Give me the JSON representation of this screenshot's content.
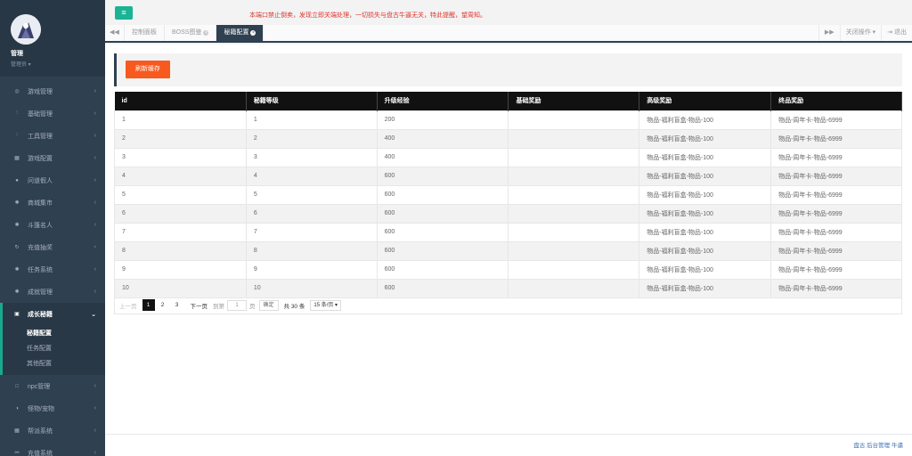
{
  "profile": {
    "name": "管理",
    "role": "管理员 ▾"
  },
  "sidebar": {
    "items_top": [
      {
        "label": "游戏管理",
        "icon": "gamepad-icon",
        "glyph": "◎"
      },
      {
        "label": "基础管理",
        "icon": "cutlery-icon",
        "glyph": "⫶"
      },
      {
        "label": "工具管理",
        "icon": "cutlery-icon",
        "glyph": "⫶"
      },
      {
        "label": "游戏配置",
        "icon": "grid-icon",
        "glyph": "▦"
      },
      {
        "label": "问道假人",
        "icon": "user-icon",
        "glyph": "●"
      },
      {
        "label": "商城集市",
        "icon": "gear-icon",
        "glyph": "✺"
      },
      {
        "label": "斗篷名人",
        "icon": "gear-icon",
        "glyph": "✺"
      },
      {
        "label": "充值抽奖",
        "icon": "refresh-icon",
        "glyph": "↻"
      },
      {
        "label": "任务系统",
        "icon": "gear-icon",
        "glyph": "✺"
      },
      {
        "label": "成就管理",
        "icon": "gear-icon",
        "glyph": "✺"
      }
    ],
    "active": {
      "label": "成长秘籍",
      "icon": "id-card-icon",
      "glyph": "▣"
    },
    "subitems": [
      "秘籍配置",
      "任务配置",
      "其他配置"
    ],
    "items_bottom": [
      {
        "label": "npc管理",
        "icon": "square-icon",
        "glyph": "□"
      },
      {
        "label": "怪物/宠物",
        "icon": "contrast-icon",
        "glyph": "◑"
      },
      {
        "label": "帮派系统",
        "icon": "grid-icon",
        "glyph": "▦"
      },
      {
        "label": "充值系统",
        "icon": "link-icon",
        "glyph": "⚯"
      }
    ]
  },
  "topbar": {
    "menu_glyph": "≡",
    "notice": "本端口禁止倒卖，发现立即关端处理，一切损失与盘古牛逼无关，特此提醒，望周知。"
  },
  "tabbar": {
    "left_glyph": "◀◀",
    "tabs": [
      {
        "label": "控制面板"
      },
      {
        "label": "BOSS图鉴"
      },
      {
        "label": "秘籍配置"
      }
    ],
    "right_glyph": "▶▶",
    "close_ops": "关闭操作 ▾",
    "logout": "退出"
  },
  "toolbar": {
    "refresh_label": "刷新缓存"
  },
  "table": {
    "headers": [
      "id",
      "秘籍等级",
      "升级经验",
      "基础奖励",
      "高级奖励",
      "终品奖励"
    ],
    "rows": [
      [
        "1",
        "1",
        "200",
        "",
        "物品-福利盲盒-物品-100",
        "物品-周年卡-物品-6999"
      ],
      [
        "2",
        "2",
        "400",
        "",
        "物品-福利盲盒-物品-100",
        "物品-周年卡-物品-6999"
      ],
      [
        "3",
        "3",
        "400",
        "",
        "物品-福利盲盒-物品-100",
        "物品-周年卡-物品-6999"
      ],
      [
        "4",
        "4",
        "600",
        "",
        "物品-福利盲盒-物品-100",
        "物品-周年卡-物品-6999"
      ],
      [
        "5",
        "5",
        "600",
        "",
        "物品-福利盲盒-物品-100",
        "物品-周年卡-物品-6999"
      ],
      [
        "6",
        "6",
        "600",
        "",
        "物品-福利盲盒-物品-100",
        "物品-周年卡-物品-6999"
      ],
      [
        "7",
        "7",
        "600",
        "",
        "物品-福利盲盒-物品-100",
        "物品-周年卡-物品-6999"
      ],
      [
        "8",
        "8",
        "600",
        "",
        "物品-福利盲盒-物品-100",
        "物品-周年卡-物品-6999"
      ],
      [
        "9",
        "9",
        "600",
        "",
        "物品-福利盲盒-物品-100",
        "物品-周年卡-物品-6999"
      ],
      [
        "10",
        "10",
        "600",
        "",
        "物品-福利盲盒-物品-100",
        "物品-周年卡-物品-6999"
      ]
    ]
  },
  "pager": {
    "prev": "上一页",
    "pages": [
      "1",
      "2",
      "3"
    ],
    "next": "下一页",
    "goto": "到第",
    "goto_value": "1",
    "page_unit": "页",
    "confirm": "确定",
    "total": "共 30 条",
    "per_page": "15 条/页 ▾"
  },
  "footer": {
    "text": "盘古 后台管理 牛逼"
  }
}
